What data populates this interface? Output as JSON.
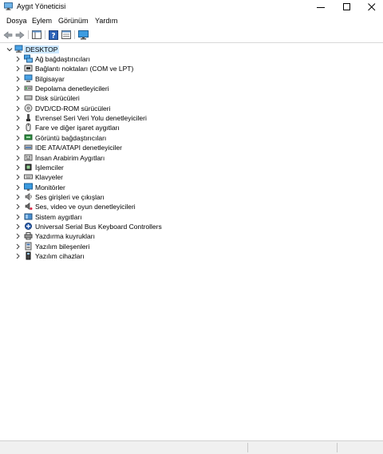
{
  "window": {
    "title": "Aygıt Yöneticisi"
  },
  "menu": [
    "Dosya",
    "Eylem",
    "Görünüm",
    "Yardım"
  ],
  "tree": {
    "root": "DESKTOP",
    "items": [
      {
        "label": "Ağ bağdaştırıcıları",
        "icon": "network-adapter-icon"
      },
      {
        "label": "Bağlantı noktaları (COM ve LPT)",
        "icon": "port-icon"
      },
      {
        "label": "Bilgisayar",
        "icon": "computer-icon"
      },
      {
        "label": "Depolama denetleyicileri",
        "icon": "storage-controller-icon"
      },
      {
        "label": "Disk sürücüleri",
        "icon": "disk-drive-icon"
      },
      {
        "label": "DVD/CD-ROM sürücüleri",
        "icon": "dvd-drive-icon"
      },
      {
        "label": "Evrensel Seri Veri Yolu denetleyicileri",
        "icon": "usb-controller-icon"
      },
      {
        "label": "Fare ve diğer işaret aygıtları",
        "icon": "mouse-icon"
      },
      {
        "label": "Görüntü bağdaştırıcıları",
        "icon": "display-adapter-icon"
      },
      {
        "label": "IDE ATA/ATAPI denetleyiciler",
        "icon": "ide-controller-icon"
      },
      {
        "label": "İnsan Arabirim Aygıtları",
        "icon": "hid-icon"
      },
      {
        "label": "İşlemciler",
        "icon": "processor-icon"
      },
      {
        "label": "Klavyeler",
        "icon": "keyboard-icon"
      },
      {
        "label": "Monitörler",
        "icon": "monitor-icon"
      },
      {
        "label": "Ses girişleri ve çıkışları",
        "icon": "audio-io-icon"
      },
      {
        "label": "Ses, video ve oyun denetleyicileri",
        "icon": "sound-video-icon"
      },
      {
        "label": "Sistem aygıtları",
        "icon": "system-device-icon"
      },
      {
        "label": "Universal Serial Bus Keyboard Controllers",
        "icon": "usb-keyboard-controller-icon"
      },
      {
        "label": "Yazdırma kuyrukları",
        "icon": "print-queue-icon"
      },
      {
        "label": "Yazılım bileşenleri",
        "icon": "software-component-icon"
      },
      {
        "label": "Yazılım cihazları",
        "icon": "software-device-icon"
      }
    ]
  },
  "colors": {
    "selection": "#cce8ff",
    "accent": "#2a7fd4"
  }
}
